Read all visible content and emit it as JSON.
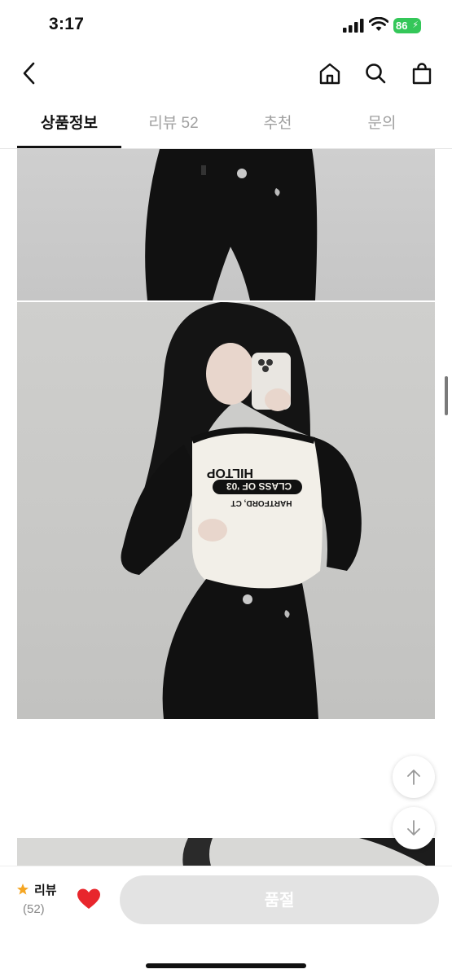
{
  "status_bar": {
    "time": "3:17",
    "battery": "86"
  },
  "tabs": [
    {
      "label": "상품정보",
      "active": true
    },
    {
      "label": "리뷰 52",
      "active": false
    },
    {
      "label": "추천",
      "active": false
    },
    {
      "label": "문의",
      "active": false
    }
  ],
  "photos": {
    "shirt_print_line1": "HILTOP",
    "shirt_print_line2": "CLASS OF '03",
    "shirt_print_line3": "HARTFORD, CT"
  },
  "bottom_bar": {
    "review_label": "리뷰",
    "review_count": "(52)",
    "buy_button_label": "품절"
  },
  "colors": {
    "accent_star": "#f5a623",
    "heart": "#e8262c",
    "soldout_bg": "#e3e3e3"
  }
}
